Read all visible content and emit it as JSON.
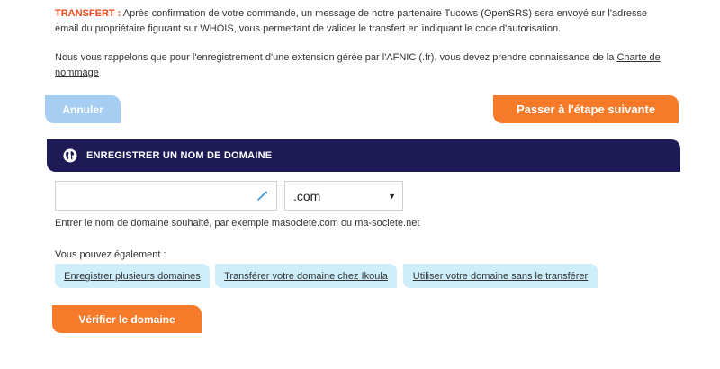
{
  "notice": {
    "transfer_lead": "TRANSFERT :",
    "transfer_text": " Après confirmation de votre commande, un message de notre partenaire Tucows (OpenSRS) sera envoyé sur l'adresse email du propriétaire figurant sur WHOIS, vous permettant de valider le transfert en indiquant le code d'autorisation.",
    "afnic_text": "Nous vous rappelons que pour l'enregistrement d'une extension gérée par l'AFNIC (.fr), vous devez prendre connaissance de la ",
    "charter_link": "Charte de nommage"
  },
  "actions": {
    "cancel_label": "Annuler",
    "next_label": "Passer à l'étape suivante"
  },
  "panel": {
    "title": "ENREGISTRER UN NOM DE DOMAINE",
    "icon": "globe-icon"
  },
  "search": {
    "domain_value": "",
    "domain_placeholder": "",
    "input_icon": "pen-icon",
    "extension_selected": ".com",
    "hint": "Entrer le nom de domaine souhaité, par exemple masociete.com ou ma-societe.net"
  },
  "alternatives": {
    "label": "Vous pouvez également :",
    "options": [
      "Enregistrer plusieurs domaines",
      "Transférer votre domaine chez Ikoula",
      "Utiliser votre domaine sans le transférer"
    ]
  },
  "verify_label": "Vérifier le domaine",
  "colors": {
    "accent_orange": "#f57b2a",
    "transfer_red": "#e8491d",
    "header_navy": "#1e1a55",
    "cancel_blue": "#a6cdf2",
    "option_bg": "#cdeefa"
  }
}
